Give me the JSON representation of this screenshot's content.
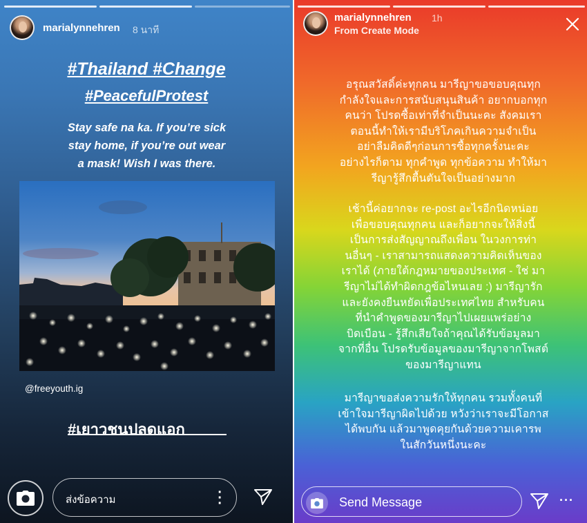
{
  "left_story": {
    "username": "marialynnehren",
    "time": "8 นาที",
    "hashtags_line1": "#Thailand #Change",
    "hashtags_line2": "#PeacefulProtest",
    "caption_lines": [
      "Stay safe na ka. If you’re sick",
      "stay home, if you’re out wear",
      "a mask! Wish I was there."
    ],
    "photo_credit": "@freeyouth.ig",
    "thai_hashtag": "#เยาวชนปลดแอก",
    "message_placeholder": "ส่งข้อความ"
  },
  "right_story": {
    "username": "marialynnehren",
    "time": "1h",
    "subtitle": "From Create Mode",
    "paragraph1": [
      "อรุณสวัสดิ์ค่ะทุกคน มารีญาขอขอบคุณทุก",
      "กำลังใจและการสนับสนุนสินค้า อยากบอกทุก",
      "คนว่า โปรดซื้อเท่าที่จำเป็นนะคะ สังคมเรา",
      "ตอนนี้ทำให้เรามีบริโภคเกินความจำเป็น",
      "อย่าลืมคิดดีๆก่อนการซื้อทุกครั้งนะคะ",
      "อย่างไรก็ตาม ทุกคำพูด ทุกข้อความ ทำให้มา",
      "รีญารู้สึกตื้นตันใจเป็นอย่างมาก"
    ],
    "paragraph2": [
      "เช้านี้ค่อยากจะ re-post อะไรอีกนิดหน่อย",
      "เพื่อขอบคุณทุกคน และก็อยากจะให้สิ่งนี้",
      "เป็นการส่งสัญญาณถึงเพื่อน ในวงการท่า",
      "นอื่นๆ - เราสามารถแสดงความคิดเห็นของ",
      "เราได้ (ภายใต้กฎหมายของประเทศ - ใช่ มา",
      "รีญาไม่ได้ทำผิดกฎข้อไหนเลย :) มารีญารัก",
      "และยังคงยืนหยัดเพื่อประเทศไทย สำหรับคน",
      "ที่นำคำพูดของมารีญาไปเผยแพร่อย่าง",
      "บิดเบือน - รู้สึกเสียใจถ้าคุณได้รับข้อมูลมา",
      "จากที่อื่น โปรดรับข้อมูลของมารีญาจากโพสต์",
      "ของมารีญาแทน"
    ],
    "paragraph3": [
      "มารีญาขอส่งความรักให้ทุกคน รวมทั้งคนที่",
      "เข้าใจมารีญาผิดไปด้วย หวังว่าเราจะมีโอกาส",
      "ได้พบกัน แล้วมาพูดคุยกันด้วยความเคารพ",
      "ในสักวันหนึ่งนะคะ"
    ],
    "message_placeholder": "Send Message",
    "more_label": "···"
  },
  "icons": {
    "camera": "camera-icon",
    "send": "paper-plane-icon",
    "more": "vertical-dots-icon",
    "close": "close-icon"
  }
}
